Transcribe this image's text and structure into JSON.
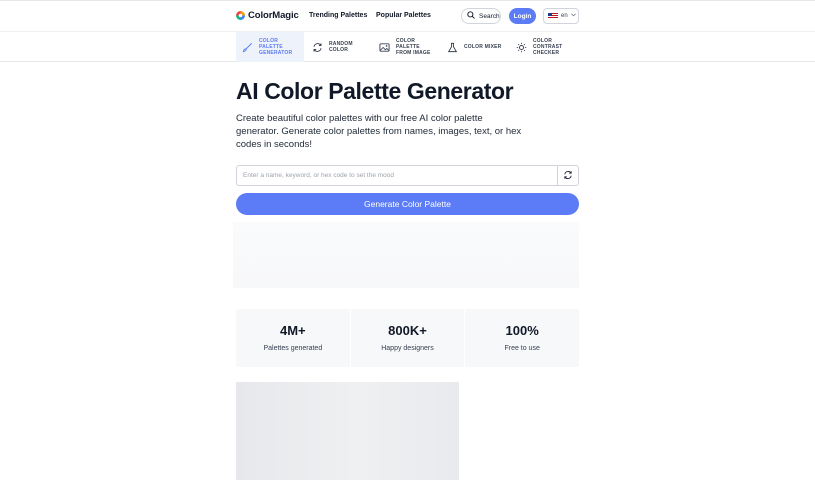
{
  "brand": {
    "name": "ColorMagic"
  },
  "nav": {
    "links": [
      "Trending Palettes",
      "Popular Palettes"
    ],
    "search_label": "Search",
    "login_label": "Login",
    "language": "en"
  },
  "tools": [
    {
      "label": "COLOR\nPALETTE\nGENERATOR",
      "icon": "brush-icon",
      "active": true
    },
    {
      "label": "RANDOM\nCOLOR",
      "icon": "refresh-icon",
      "active": false
    },
    {
      "label": "COLOR\nPALETTE\nFROM IMAGE",
      "icon": "image-icon",
      "active": false
    },
    {
      "label": "COLOR MIXER",
      "icon": "flask-icon",
      "active": false
    },
    {
      "label": "COLOR\nCONTRAST\nCHECKER",
      "icon": "sun-icon",
      "active": false
    }
  ],
  "hero": {
    "title": "AI Color Palette Generator",
    "subtitle": "Create beautiful color palettes with our free AI color palette generator. Generate color palettes from names, images, text, or hex codes in seconds!",
    "input_placeholder": "Enter a name, keyword, or hex code to set the mood",
    "input_value": "",
    "generate_label": "Generate Color Palette"
  },
  "stats": [
    {
      "value": "4M+",
      "label": "Palettes generated"
    },
    {
      "value": "800K+",
      "label": "Happy designers"
    },
    {
      "value": "100%",
      "label": "Free to use"
    }
  ],
  "colors": {
    "accent": "#5b7cf6",
    "text": "#111827",
    "panel": "#f7f8fa"
  }
}
